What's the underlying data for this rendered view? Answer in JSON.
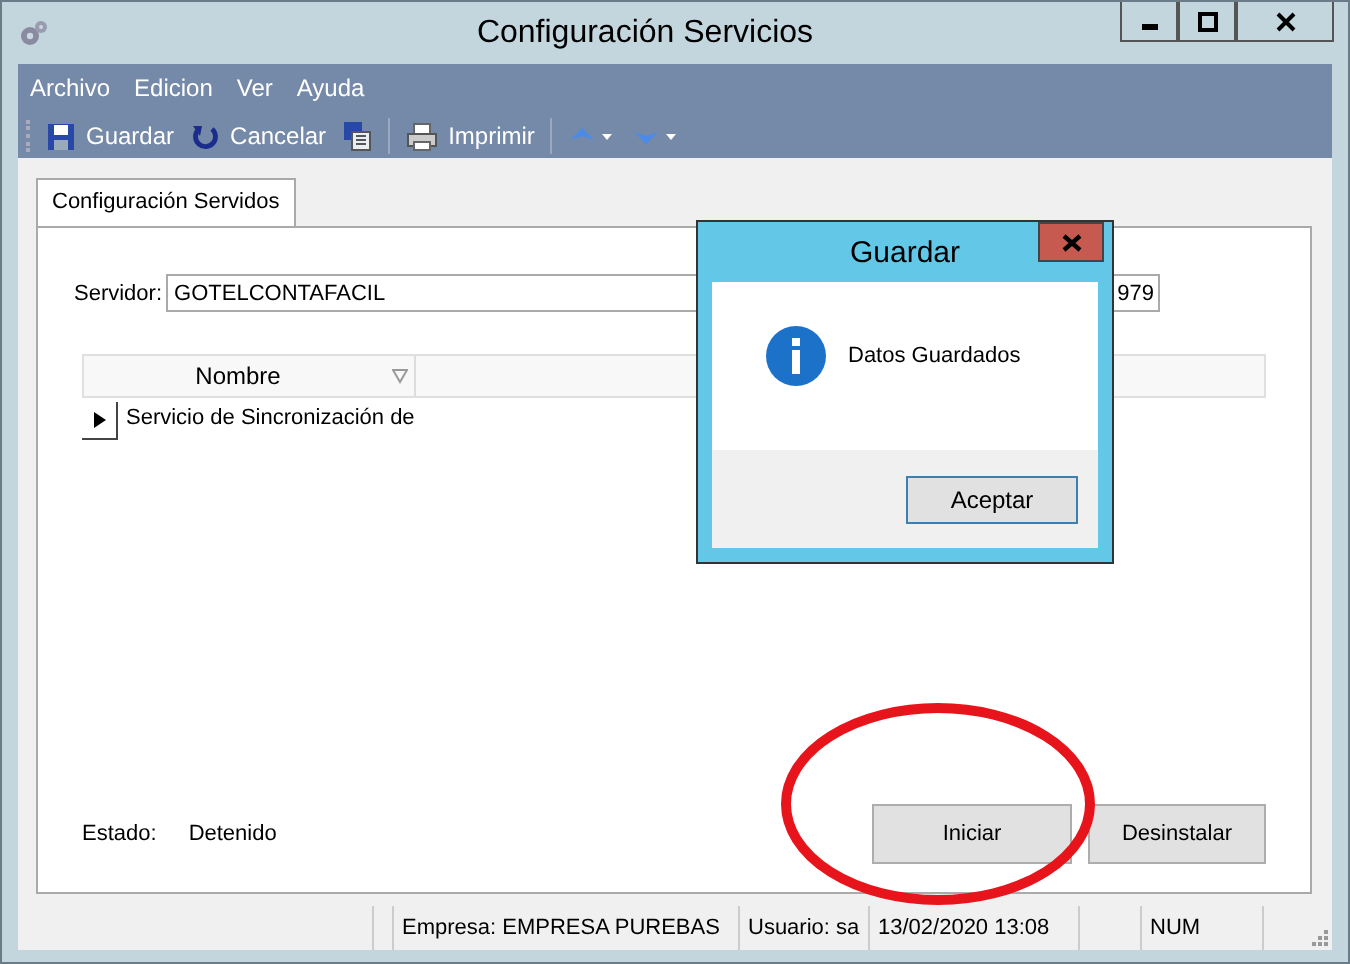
{
  "window": {
    "title": "Configuración Servicios"
  },
  "menu": [
    "Archivo",
    "Edicion",
    "Ver",
    "Ayuda"
  ],
  "toolbar": [
    {
      "kind": "save",
      "label": "Guardar"
    },
    {
      "kind": "undo",
      "label": "Cancelar"
    },
    {
      "kind": "export"
    },
    {
      "kind": "separator"
    },
    {
      "kind": "print",
      "label": "Imprimir"
    },
    {
      "kind": "separator"
    },
    {
      "kind": "up"
    },
    {
      "kind": "down"
    }
  ],
  "tabs": [
    {
      "label": "Configuración Servidos",
      "selected": true
    }
  ],
  "server": {
    "label": "Servidor:",
    "value": "GOTELCONTAFACIL",
    "value_2": "979"
  },
  "grid": {
    "columns": [
      "Nombre"
    ],
    "rows": [
      {
        "name": "Servicio de Sincronización de"
      }
    ]
  },
  "state": {
    "label": "Estado:",
    "value": "Detenido"
  },
  "buttons": [
    "Iniciar",
    "Desinstalar"
  ],
  "status_bar": [
    "Empresa: EMPRESA PUREBAS",
    "Usuario: sa",
    "13/02/2020 13:08",
    "NUM"
  ],
  "dialog": {
    "title": "Guardar",
    "message": "Datos Guardados",
    "button": "Aceptar"
  }
}
